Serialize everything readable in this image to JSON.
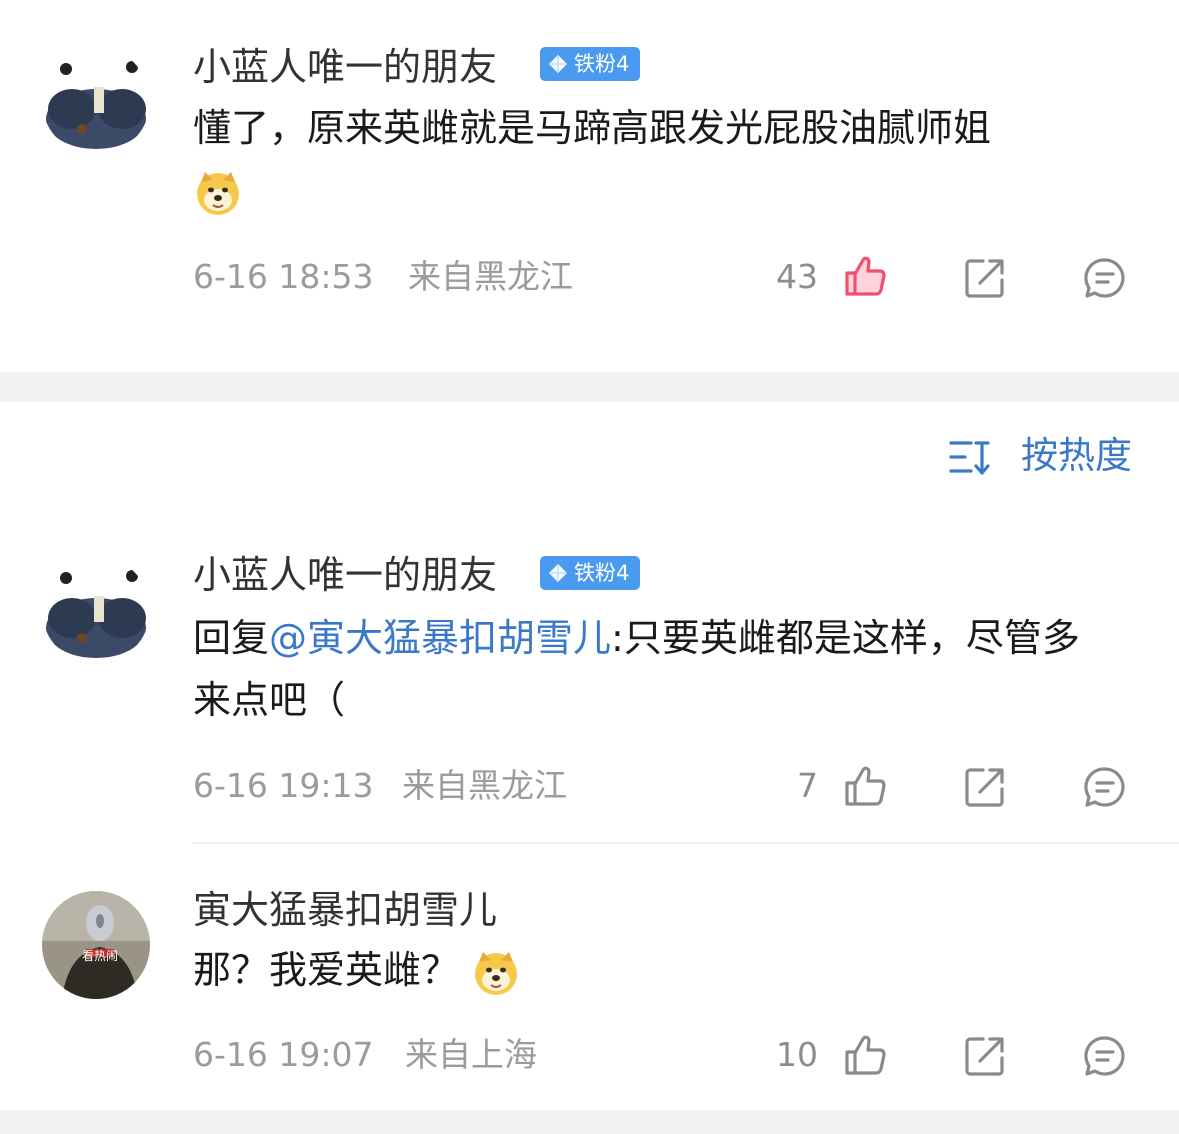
{
  "comments": [
    {
      "username": "小蓝人唯一的朋友",
      "badge": "铁粉4",
      "text": "懂了，原来英雌就是马蹄高跟发光屁股油腻师姐",
      "time": "6-16 18:53",
      "location": "来自黑龙江",
      "likes": "43",
      "liked": true
    }
  ],
  "sort": {
    "label": "按热度",
    "icon": "sort-icon"
  },
  "thread": [
    {
      "username": "小蓝人唯一的朋友",
      "badge": "铁粉4",
      "reply_prefix": "回复",
      "mention": "@寅大猛暴扣胡雪儿",
      "text": ":只要英雌都是这样，尽管多来点吧（",
      "time": "6-16 19:13",
      "location": "来自黑龙江",
      "likes": "7",
      "liked": false
    },
    {
      "username": "寅大猛暴扣胡雪儿",
      "avatar_text": "看热闹",
      "text": "那？我爱英雌？",
      "time": "6-16 19:07",
      "location": "来自上海",
      "likes": "10",
      "liked": false
    }
  ],
  "icons": {
    "like": "thumbs-up-icon",
    "share": "share-icon",
    "comment": "comment-icon",
    "emoji": "doge-emoji-icon"
  },
  "colors": {
    "mention": "#3a78c9",
    "liked": "#f0506e",
    "badge": "#4a9af0",
    "meta": "#9b9b9b"
  }
}
